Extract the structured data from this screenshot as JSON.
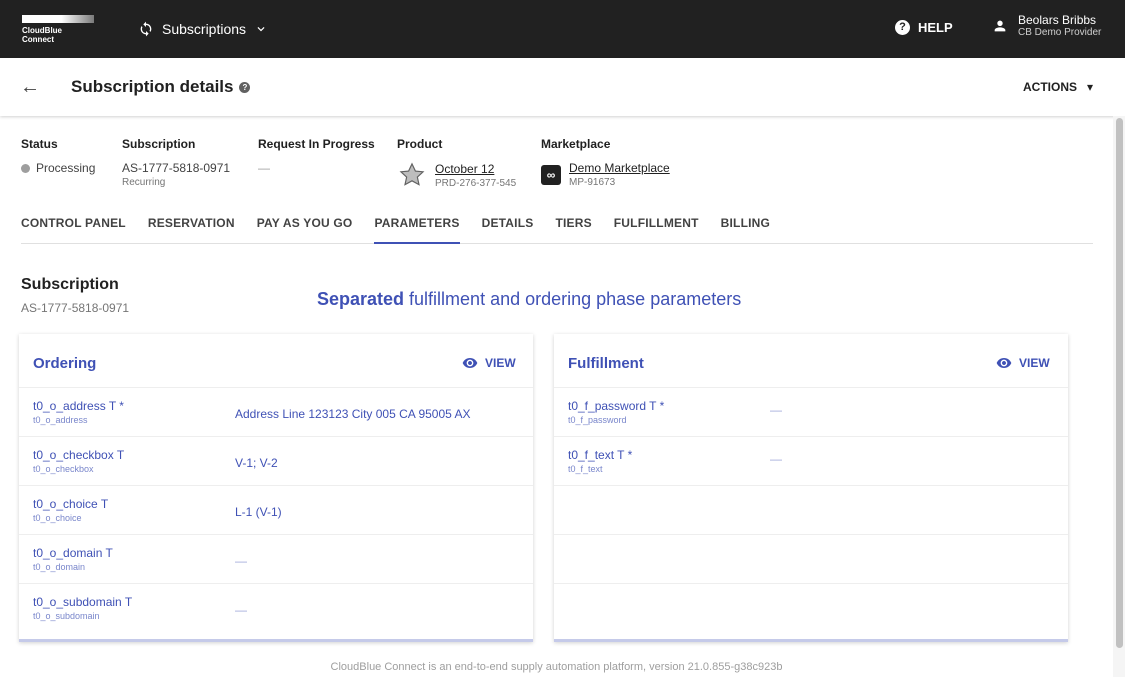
{
  "topbar": {
    "logo_line1": "CloudBlue",
    "logo_line2": "Connect",
    "app_label": "Subscriptions",
    "help_label": "HELP",
    "user_name": "Beolars Bribbs",
    "user_org": "CB Demo Provider"
  },
  "header": {
    "title": "Subscription details",
    "actions_label": "ACTIONS"
  },
  "summary": {
    "status_label": "Status",
    "status_value": "Processing",
    "subscription_label": "Subscription",
    "subscription_id": "AS-1777-5818-0971",
    "subscription_type": "Recurring",
    "request_label": "Request In Progress",
    "request_value": "—",
    "product_label": "Product",
    "product_name": "October 12",
    "product_id": "PRD-276-377-545",
    "marketplace_label": "Marketplace",
    "marketplace_name": "Demo Marketplace",
    "marketplace_id": "MP-91673"
  },
  "tabs": [
    {
      "label": "CONTROL PANEL"
    },
    {
      "label": "RESERVATION"
    },
    {
      "label": "PAY AS YOU GO"
    },
    {
      "label": "PARAMETERS",
      "active": true
    },
    {
      "label": "DETAILS"
    },
    {
      "label": "TIERS"
    },
    {
      "label": "FULFILLMENT"
    },
    {
      "label": "BILLING"
    }
  ],
  "section": {
    "title": "Subscription",
    "id": "AS-1777-5818-0971",
    "banner_bold": "Separated",
    "banner_rest": " fulfillment and ordering phase parameters"
  },
  "ordering": {
    "title": "Ordering",
    "view_label": "VIEW",
    "params": [
      {
        "name": "t0_o_address T *",
        "id": "t0_o_address",
        "value": "Address Line 123123 City 005 CA 95005 AX"
      },
      {
        "name": "t0_o_checkbox T",
        "id": "t0_o_checkbox",
        "value": "V-1; V-2"
      },
      {
        "name": "t0_o_choice T",
        "id": "t0_o_choice",
        "value": "L-1 (V-1)"
      },
      {
        "name": "t0_o_domain T",
        "id": "t0_o_domain",
        "value": "—"
      },
      {
        "name": "t0_o_subdomain T",
        "id": "t0_o_subdomain",
        "value": "—"
      }
    ]
  },
  "fulfillment": {
    "title": "Fulfillment",
    "view_label": "VIEW",
    "params": [
      {
        "name": "t0_f_password T *",
        "id": "t0_f_password",
        "value": "—"
      },
      {
        "name": "t0_f_text T *",
        "id": "t0_f_text",
        "value": "—"
      }
    ]
  },
  "footer": {
    "text": "CloudBlue Connect is an end-to-end supply automation platform, version 21.0.855-g38c923b"
  },
  "colors": {
    "accent": "#3f51b5",
    "topbar": "#212121"
  }
}
